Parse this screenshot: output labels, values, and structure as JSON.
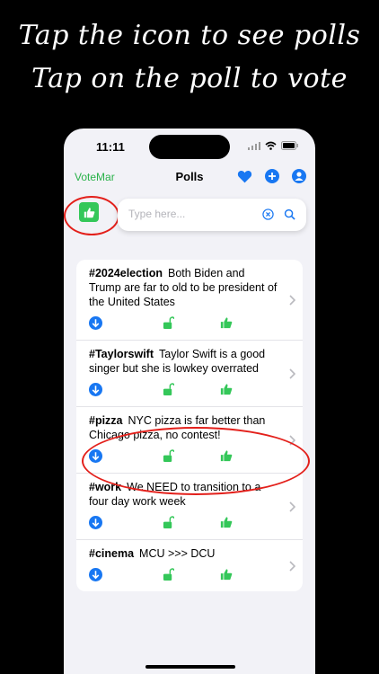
{
  "caption": {
    "line1": "Tap the icon to see polls",
    "line2": "Tap on the poll to vote"
  },
  "status_bar": {
    "time": "11:11"
  },
  "nav": {
    "brand": "VoteMar",
    "title": "Polls"
  },
  "search": {
    "placeholder": "Type here..."
  },
  "polls": [
    {
      "tag": "#2024election",
      "text": "Both Biden and Trump are far to old to be president of the United States"
    },
    {
      "tag": "#Taylorswift",
      "text": "Taylor Swift is a good singer but she is lowkey overrated"
    },
    {
      "tag": "#pizza",
      "text": "NYC pizza is far better than Chicago pizza, no contest!"
    },
    {
      "tag": "#work",
      "text": "We NEED to transition to a four day work week"
    },
    {
      "tag": "#cinema",
      "text": "MCU >>> DCU"
    }
  ],
  "colors": {
    "accent_blue": "#1877f2",
    "brand_green": "#2ab24a",
    "highlight_red": "#e3201b"
  },
  "icons": [
    "down-arrow-icon",
    "unlock-icon",
    "thumbs-up-icon",
    "heart-icon",
    "plus-icon",
    "profile-icon",
    "clear-icon",
    "search-icon",
    "chevron-right-icon"
  ]
}
